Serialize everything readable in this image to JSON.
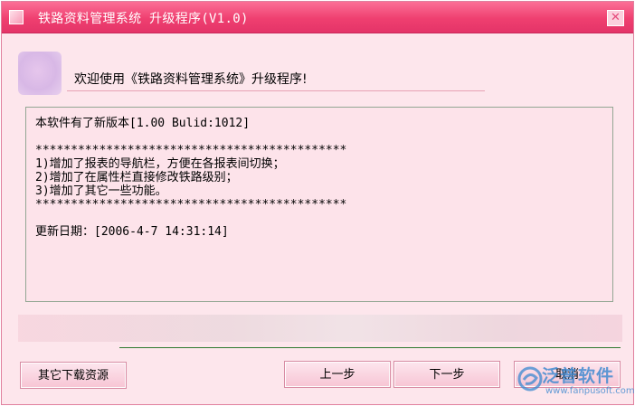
{
  "window": {
    "title": "铁路资料管理系统 升级程序(V1.0)",
    "close_label": "✕"
  },
  "header": {
    "welcome_text": "欢迎使用《铁路资料管理系统》升级程序!"
  },
  "release_notes": {
    "lines": [
      "本软件有了新版本[1.00 Bulid:1012]",
      "",
      "********************************************",
      "1)增加了报表的导航栏，方便在各报表间切换；",
      "2)增加了在属性栏直接修改铁路级别；",
      "3)增加了其它一些功能。",
      "********************************************",
      "",
      "更新日期：[2006-4-7 14:31:14]"
    ]
  },
  "buttons": {
    "other_downloads": "其它下载资源",
    "prev": "上一步",
    "next": "下一步",
    "cancel": "取消"
  },
  "watermark": {
    "text": "泛普软件",
    "url": "www.fanpusoft.com"
  },
  "colors": {
    "titlebar": "#ef3f70",
    "window_bg": "#fde6ec",
    "notes_border": "#93a793",
    "progress_line": "#2f7a2f",
    "watermark": "#3b88d0"
  },
  "icons": {
    "title": "app-icon",
    "close": "close-icon",
    "header": "app-logo-icon",
    "watermark": "fanpu-logo-icon"
  }
}
